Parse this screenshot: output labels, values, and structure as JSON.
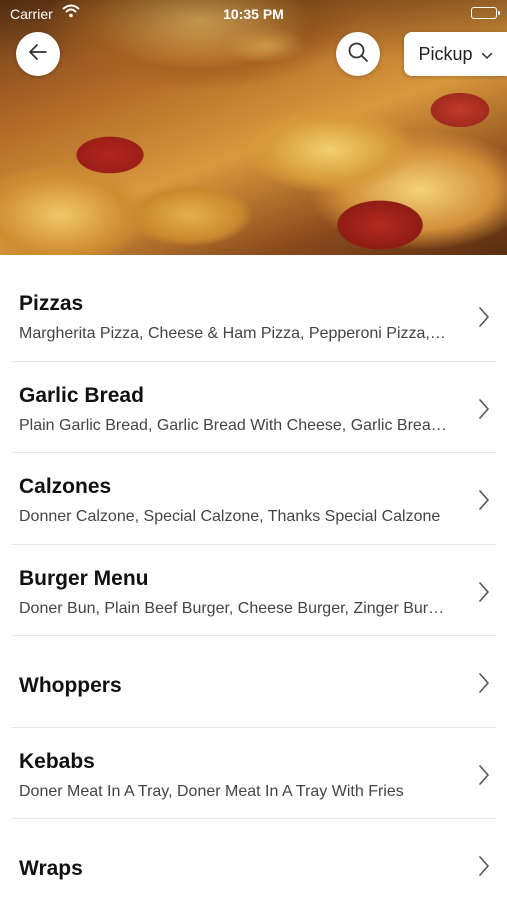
{
  "status_bar": {
    "carrier": "Carrier",
    "time": "10:35 PM"
  },
  "header": {
    "back_icon": "arrow-left-icon",
    "search_icon": "search-icon",
    "pickup_label": "Pickup",
    "pickup_icon": "chevron-down-icon"
  },
  "colors": {
    "background": "#ffffff",
    "title_text": "#111111",
    "subtitle_text": "#444444",
    "divider": "#e8e8e8"
  },
  "categories": [
    {
      "title": "Pizzas",
      "subtitle": "Margherita Pizza, Cheese & Ham Pizza, Pepperoni Pizza, Hawaiian Pizza"
    },
    {
      "title": "Garlic Bread",
      "subtitle": "Plain Garlic Bread, Garlic Bread With Cheese, Garlic Bread With Cheese & Tomato"
    },
    {
      "title": "Calzones",
      "subtitle": "Donner Calzone, Special Calzone, Thanks Special Calzone"
    },
    {
      "title": "Burger Menu",
      "subtitle": "Doner Bun, Plain Beef Burger, Cheese Burger, Zinger Burger"
    },
    {
      "title": "Whoppers",
      "subtitle": ""
    },
    {
      "title": "Kebabs",
      "subtitle": "Doner Meat In A Tray, Doner Meat In A Tray With Fries"
    },
    {
      "title": "Wraps",
      "subtitle": ""
    }
  ]
}
